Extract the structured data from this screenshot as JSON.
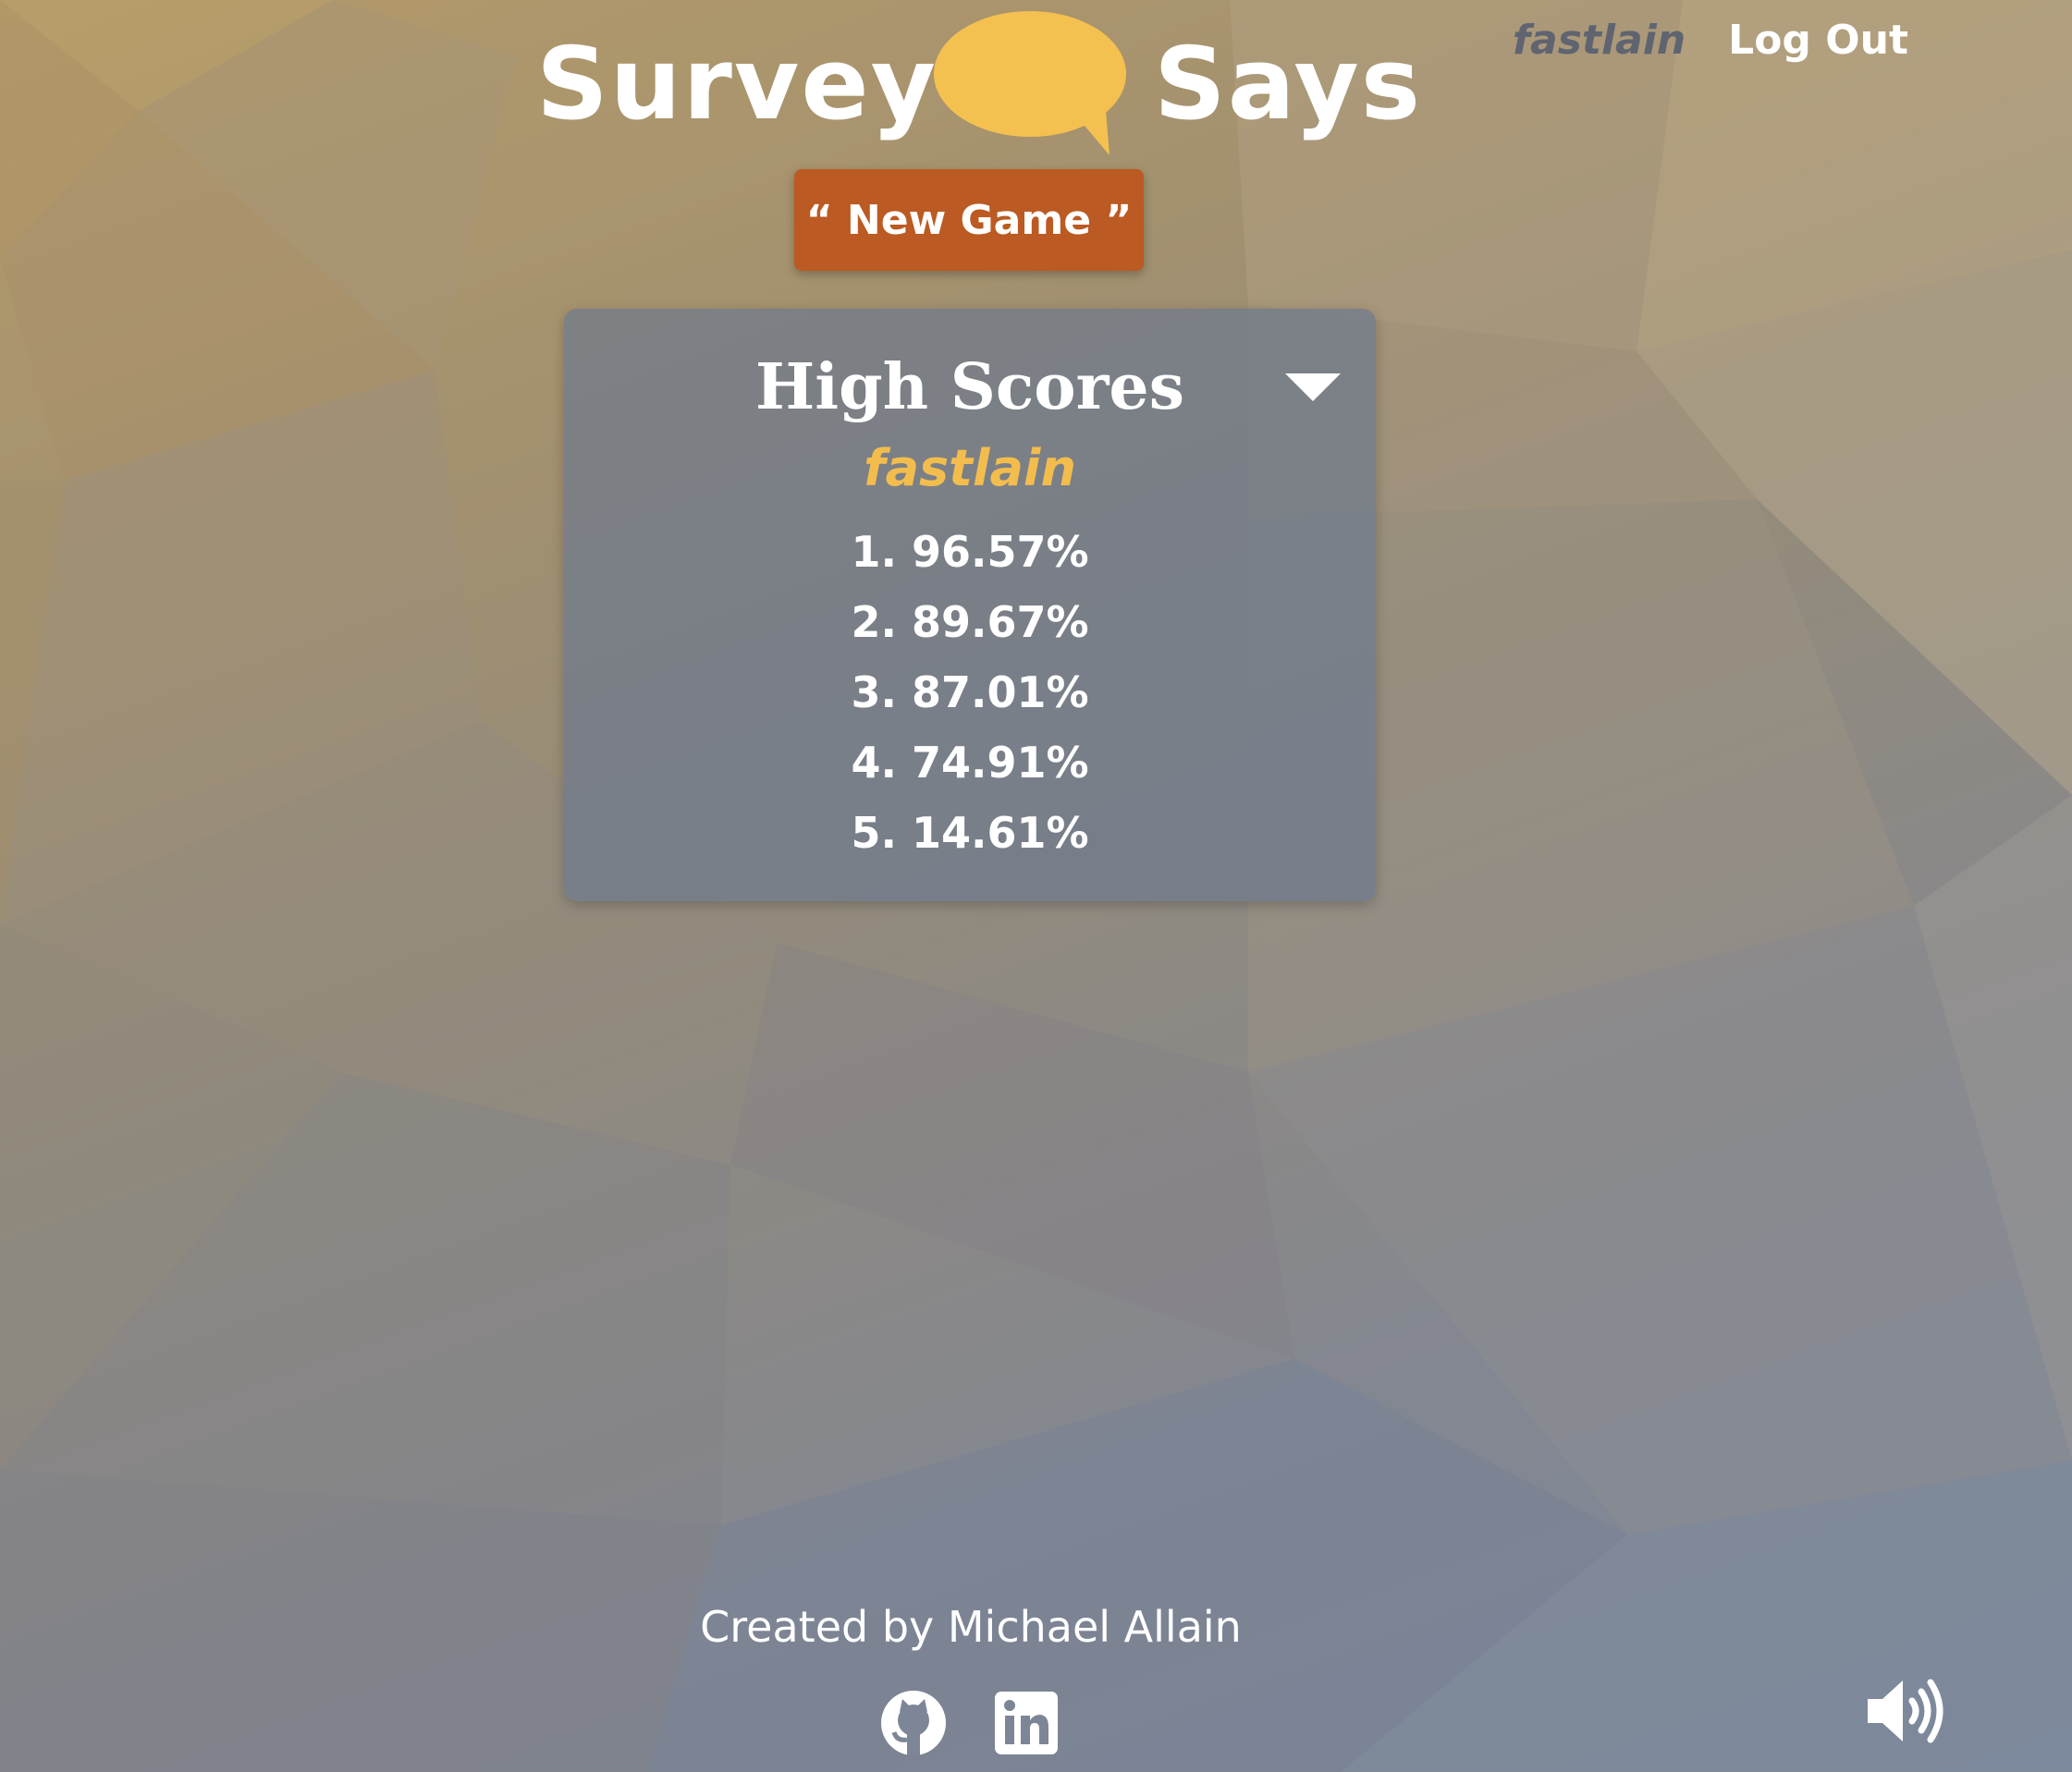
{
  "header": {
    "logo_left": "Survey",
    "logo_right": "Says",
    "username": "fastlain",
    "logout_label": "Log Out"
  },
  "actions": {
    "new_game_label": "“ New Game ”"
  },
  "high_scores": {
    "title": "High Scores",
    "toggle_icon": "caret-down-icon",
    "user": "fastlain",
    "scores": [
      {
        "rank": "1.",
        "value": "96.57%"
      },
      {
        "rank": "2.",
        "value": "89.67%"
      },
      {
        "rank": "3.",
        "value": "87.01%"
      },
      {
        "rank": "4.",
        "value": "74.91%"
      },
      {
        "rank": "5.",
        "value": "14.61%"
      }
    ]
  },
  "footer": {
    "credit": "Created by Michael Allain",
    "links": [
      "github-icon",
      "linkedin-icon"
    ],
    "sound_icon": "volume-icon"
  },
  "colors": {
    "accent": "#f3bd4e",
    "button": "#bb5a22",
    "panel": "#6e7a8e"
  }
}
